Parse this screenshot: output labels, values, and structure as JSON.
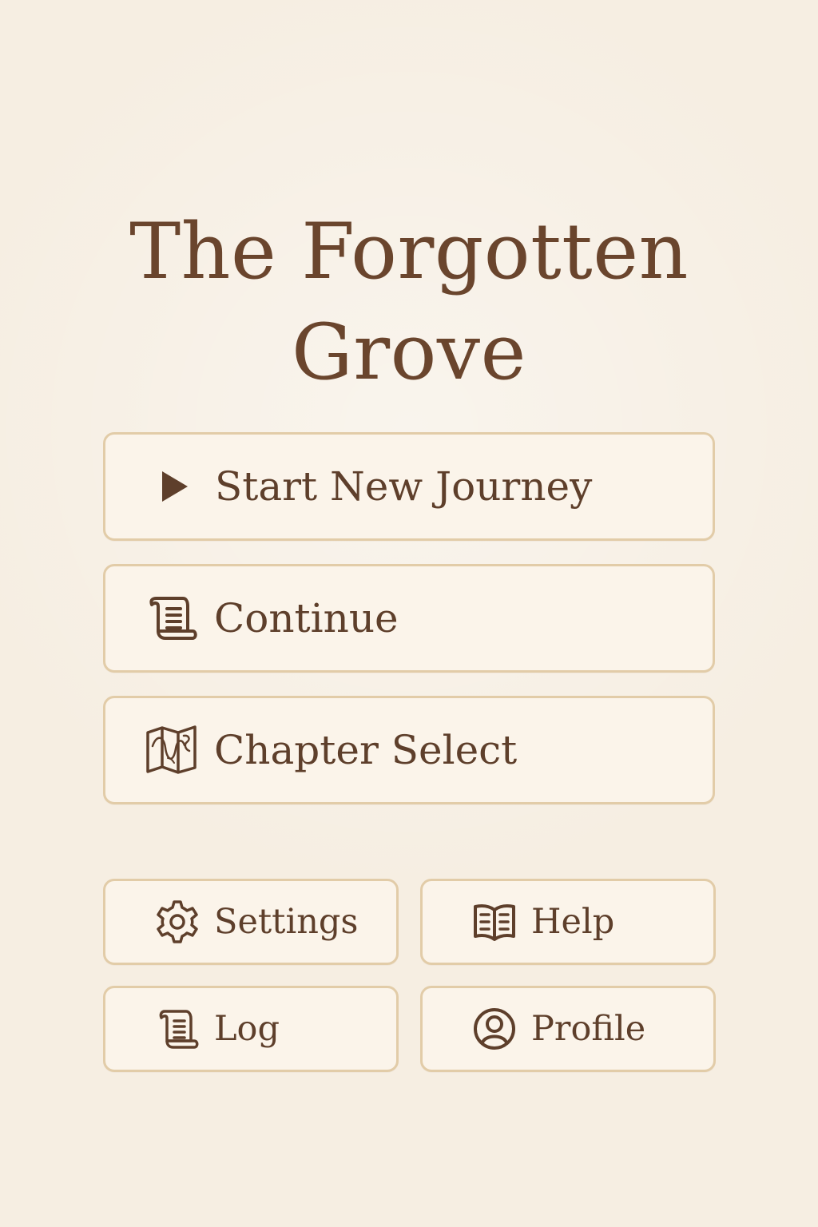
{
  "app": {
    "title_line_1": "The Forgotten",
    "title_line_2": "Grove"
  },
  "menu": {
    "primary": [
      {
        "label": "Start New Journey",
        "icon": "play-icon"
      },
      {
        "label": "Continue",
        "icon": "scroll-icon"
      },
      {
        "label": "Chapter Select",
        "icon": "map-icon"
      }
    ],
    "secondary": [
      {
        "label": "Settings",
        "icon": "gear-icon"
      },
      {
        "label": "Help",
        "icon": "book-icon"
      },
      {
        "label": "Log",
        "icon": "scroll-icon"
      },
      {
        "label": "Profile",
        "icon": "profile-icon"
      }
    ]
  },
  "colors": {
    "background": "#f6eee2",
    "button_fill": "#fbf4ea",
    "button_border": "#e2cca8",
    "text": "#5e3f2b",
    "title": "#6a452d"
  }
}
